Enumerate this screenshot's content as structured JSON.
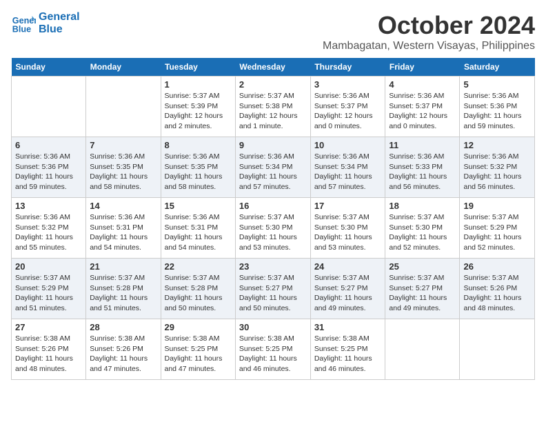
{
  "logo": {
    "line1": "General",
    "line2": "Blue"
  },
  "title": {
    "month": "October 2024",
    "location": "Mambagatan, Western Visayas, Philippines"
  },
  "weekdays": [
    "Sunday",
    "Monday",
    "Tuesday",
    "Wednesday",
    "Thursday",
    "Friday",
    "Saturday"
  ],
  "weeks": [
    [
      {
        "day": "",
        "sunrise": "",
        "sunset": "",
        "daylight": ""
      },
      {
        "day": "",
        "sunrise": "",
        "sunset": "",
        "daylight": ""
      },
      {
        "day": "1",
        "sunrise": "Sunrise: 5:37 AM",
        "sunset": "Sunset: 5:39 PM",
        "daylight": "Daylight: 12 hours and 2 minutes."
      },
      {
        "day": "2",
        "sunrise": "Sunrise: 5:37 AM",
        "sunset": "Sunset: 5:38 PM",
        "daylight": "Daylight: 12 hours and 1 minute."
      },
      {
        "day": "3",
        "sunrise": "Sunrise: 5:36 AM",
        "sunset": "Sunset: 5:37 PM",
        "daylight": "Daylight: 12 hours and 0 minutes."
      },
      {
        "day": "4",
        "sunrise": "Sunrise: 5:36 AM",
        "sunset": "Sunset: 5:37 PM",
        "daylight": "Daylight: 12 hours and 0 minutes."
      },
      {
        "day": "5",
        "sunrise": "Sunrise: 5:36 AM",
        "sunset": "Sunset: 5:36 PM",
        "daylight": "Daylight: 11 hours and 59 minutes."
      }
    ],
    [
      {
        "day": "6",
        "sunrise": "Sunrise: 5:36 AM",
        "sunset": "Sunset: 5:36 PM",
        "daylight": "Daylight: 11 hours and 59 minutes."
      },
      {
        "day": "7",
        "sunrise": "Sunrise: 5:36 AM",
        "sunset": "Sunset: 5:35 PM",
        "daylight": "Daylight: 11 hours and 58 minutes."
      },
      {
        "day": "8",
        "sunrise": "Sunrise: 5:36 AM",
        "sunset": "Sunset: 5:35 PM",
        "daylight": "Daylight: 11 hours and 58 minutes."
      },
      {
        "day": "9",
        "sunrise": "Sunrise: 5:36 AM",
        "sunset": "Sunset: 5:34 PM",
        "daylight": "Daylight: 11 hours and 57 minutes."
      },
      {
        "day": "10",
        "sunrise": "Sunrise: 5:36 AM",
        "sunset": "Sunset: 5:34 PM",
        "daylight": "Daylight: 11 hours and 57 minutes."
      },
      {
        "day": "11",
        "sunrise": "Sunrise: 5:36 AM",
        "sunset": "Sunset: 5:33 PM",
        "daylight": "Daylight: 11 hours and 56 minutes."
      },
      {
        "day": "12",
        "sunrise": "Sunrise: 5:36 AM",
        "sunset": "Sunset: 5:32 PM",
        "daylight": "Daylight: 11 hours and 56 minutes."
      }
    ],
    [
      {
        "day": "13",
        "sunrise": "Sunrise: 5:36 AM",
        "sunset": "Sunset: 5:32 PM",
        "daylight": "Daylight: 11 hours and 55 minutes."
      },
      {
        "day": "14",
        "sunrise": "Sunrise: 5:36 AM",
        "sunset": "Sunset: 5:31 PM",
        "daylight": "Daylight: 11 hours and 54 minutes."
      },
      {
        "day": "15",
        "sunrise": "Sunrise: 5:36 AM",
        "sunset": "Sunset: 5:31 PM",
        "daylight": "Daylight: 11 hours and 54 minutes."
      },
      {
        "day": "16",
        "sunrise": "Sunrise: 5:37 AM",
        "sunset": "Sunset: 5:30 PM",
        "daylight": "Daylight: 11 hours and 53 minutes."
      },
      {
        "day": "17",
        "sunrise": "Sunrise: 5:37 AM",
        "sunset": "Sunset: 5:30 PM",
        "daylight": "Daylight: 11 hours and 53 minutes."
      },
      {
        "day": "18",
        "sunrise": "Sunrise: 5:37 AM",
        "sunset": "Sunset: 5:30 PM",
        "daylight": "Daylight: 11 hours and 52 minutes."
      },
      {
        "day": "19",
        "sunrise": "Sunrise: 5:37 AM",
        "sunset": "Sunset: 5:29 PM",
        "daylight": "Daylight: 11 hours and 52 minutes."
      }
    ],
    [
      {
        "day": "20",
        "sunrise": "Sunrise: 5:37 AM",
        "sunset": "Sunset: 5:29 PM",
        "daylight": "Daylight: 11 hours and 51 minutes."
      },
      {
        "day": "21",
        "sunrise": "Sunrise: 5:37 AM",
        "sunset": "Sunset: 5:28 PM",
        "daylight": "Daylight: 11 hours and 51 minutes."
      },
      {
        "day": "22",
        "sunrise": "Sunrise: 5:37 AM",
        "sunset": "Sunset: 5:28 PM",
        "daylight": "Daylight: 11 hours and 50 minutes."
      },
      {
        "day": "23",
        "sunrise": "Sunrise: 5:37 AM",
        "sunset": "Sunset: 5:27 PM",
        "daylight": "Daylight: 11 hours and 50 minutes."
      },
      {
        "day": "24",
        "sunrise": "Sunrise: 5:37 AM",
        "sunset": "Sunset: 5:27 PM",
        "daylight": "Daylight: 11 hours and 49 minutes."
      },
      {
        "day": "25",
        "sunrise": "Sunrise: 5:37 AM",
        "sunset": "Sunset: 5:27 PM",
        "daylight": "Daylight: 11 hours and 49 minutes."
      },
      {
        "day": "26",
        "sunrise": "Sunrise: 5:37 AM",
        "sunset": "Sunset: 5:26 PM",
        "daylight": "Daylight: 11 hours and 48 minutes."
      }
    ],
    [
      {
        "day": "27",
        "sunrise": "Sunrise: 5:38 AM",
        "sunset": "Sunset: 5:26 PM",
        "daylight": "Daylight: 11 hours and 48 minutes."
      },
      {
        "day": "28",
        "sunrise": "Sunrise: 5:38 AM",
        "sunset": "Sunset: 5:26 PM",
        "daylight": "Daylight: 11 hours and 47 minutes."
      },
      {
        "day": "29",
        "sunrise": "Sunrise: 5:38 AM",
        "sunset": "Sunset: 5:25 PM",
        "daylight": "Daylight: 11 hours and 47 minutes."
      },
      {
        "day": "30",
        "sunrise": "Sunrise: 5:38 AM",
        "sunset": "Sunset: 5:25 PM",
        "daylight": "Daylight: 11 hours and 46 minutes."
      },
      {
        "day": "31",
        "sunrise": "Sunrise: 5:38 AM",
        "sunset": "Sunset: 5:25 PM",
        "daylight": "Daylight: 11 hours and 46 minutes."
      },
      {
        "day": "",
        "sunrise": "",
        "sunset": "",
        "daylight": ""
      },
      {
        "day": "",
        "sunrise": "",
        "sunset": "",
        "daylight": ""
      }
    ]
  ]
}
